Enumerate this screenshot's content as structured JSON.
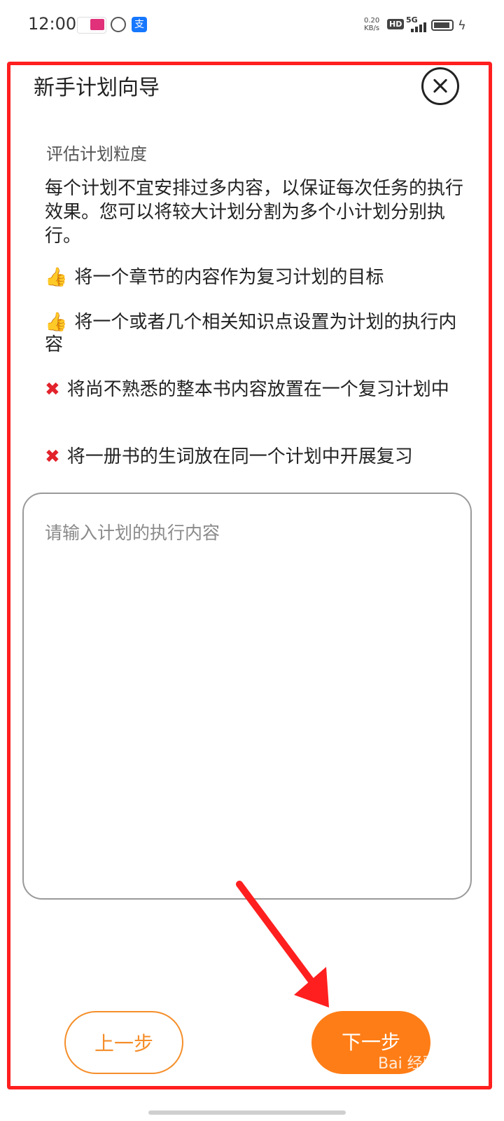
{
  "status_bar": {
    "time": "12:00",
    "net_speed_value": "0.20",
    "net_speed_unit": "KB/s",
    "hd": "HD",
    "network": "5G"
  },
  "dialog": {
    "title": "新手计划向导",
    "subtitle": "评估计划粒度",
    "description": "每个计划不宜安排过多内容，以保证每次任务的执行效果。您可以将较大计划分割为多个小计划分别执行。",
    "tips": [
      {
        "icon": "thumbs-up-icon",
        "glyph": "👍",
        "text": "将一个章节的内容作为复习计划的目标"
      },
      {
        "icon": "thumbs-up-icon",
        "glyph": "👍",
        "text": "将一个或者几个相关知识点设置为计划的执行内容"
      },
      {
        "icon": "cross-icon",
        "glyph": "✖",
        "text": "将尚不熟悉的整本书内容放置在一个复习计划中"
      },
      {
        "icon": "cross-icon",
        "glyph": "✖",
        "text": "将一册书的生词放在同一个计划中开展复习"
      }
    ],
    "input": {
      "placeholder": "请输入计划的执行内容",
      "value": ""
    },
    "prev_label": "上一步",
    "next_label": "下一步"
  },
  "watermark": "Bai 经验",
  "colors": {
    "accent": "#ff7d16",
    "highlight_frame": "#ff1f1f"
  }
}
